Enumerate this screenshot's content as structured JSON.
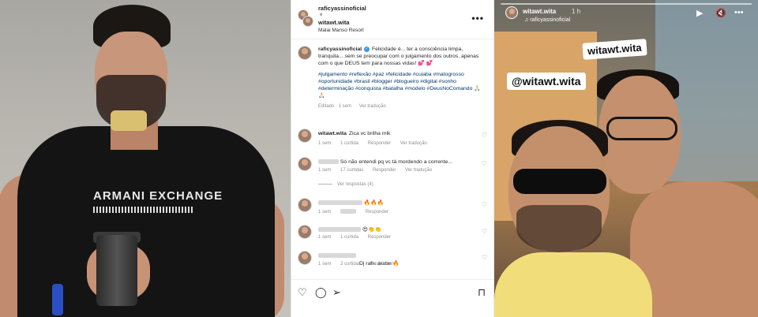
{
  "post": {
    "header": {
      "user1": "raficyassinoficial",
      "and": "e",
      "user2": "witawt.wita",
      "location": "Malai Manso Resort",
      "more_icon": "more-horizontal-icon"
    },
    "caption": {
      "user": "raficyassinoficial",
      "text": "Felicidade é... ter a consciência limpa, tranquila... sem se preocupar com o julgamento dos outros, apenas com o que DEUS tem para nossas vidas! 💕 💕",
      "hashtags": "#julgamento #reflexão #paz #felicidade #cuiaba #matogrosso #oportunidade #brasil #blogger #blogueiro #digital #sonho #determinação #conquista #batalha #modelo #DeusNoComando 🙏🏻🙏🏻",
      "time": "Editado · 1 sem",
      "translation": "Ver tradução"
    },
    "comments": [
      {
        "user": "witawt.wita",
        "text": "Zica vc brilha mlk",
        "time": "1 sem",
        "likes": "1 curtida",
        "reply": "Responder",
        "translate": "Ver tradução"
      },
      {
        "user": "",
        "text": "Só não entendi pq vc tá mordendo a corrente...",
        "time": "1 sem",
        "likes": "17 curtidas",
        "reply": "Responder",
        "translate": "Ver tradução"
      },
      {
        "user": "",
        "text": "🔥🔥🔥",
        "time": "1 sem",
        "likes": "",
        "reply": "Responder",
        "translate": ""
      },
      {
        "user": "",
        "text": "😍👏👏",
        "time": "1 sem",
        "likes": "1 curtida",
        "reply": "Responder",
        "translate": ""
      },
      {
        "user": "",
        "text": "Dj rafic árabe 🔥",
        "time": "1 sem",
        "likes": "2 curtidas",
        "reply": "Responder",
        "translate": ""
      }
    ],
    "view_replies": "Ver respostas (4)",
    "actions": [
      "heart-icon",
      "comment-icon",
      "share-icon",
      "bookmark-icon"
    ]
  },
  "left_photo": {
    "shirt_text": "ARMANI EXCHANGE"
  },
  "story": {
    "user": "witawt.wita",
    "time": "1 h",
    "music": "raficyassinoficial",
    "mention": "@witawt.wita",
    "icons": [
      "play-icon",
      "mute-icon",
      "more-horizontal-icon"
    ]
  },
  "colors": {
    "link": "#00376b",
    "verified": "#3897f0",
    "meta": "#8e8e8e"
  }
}
